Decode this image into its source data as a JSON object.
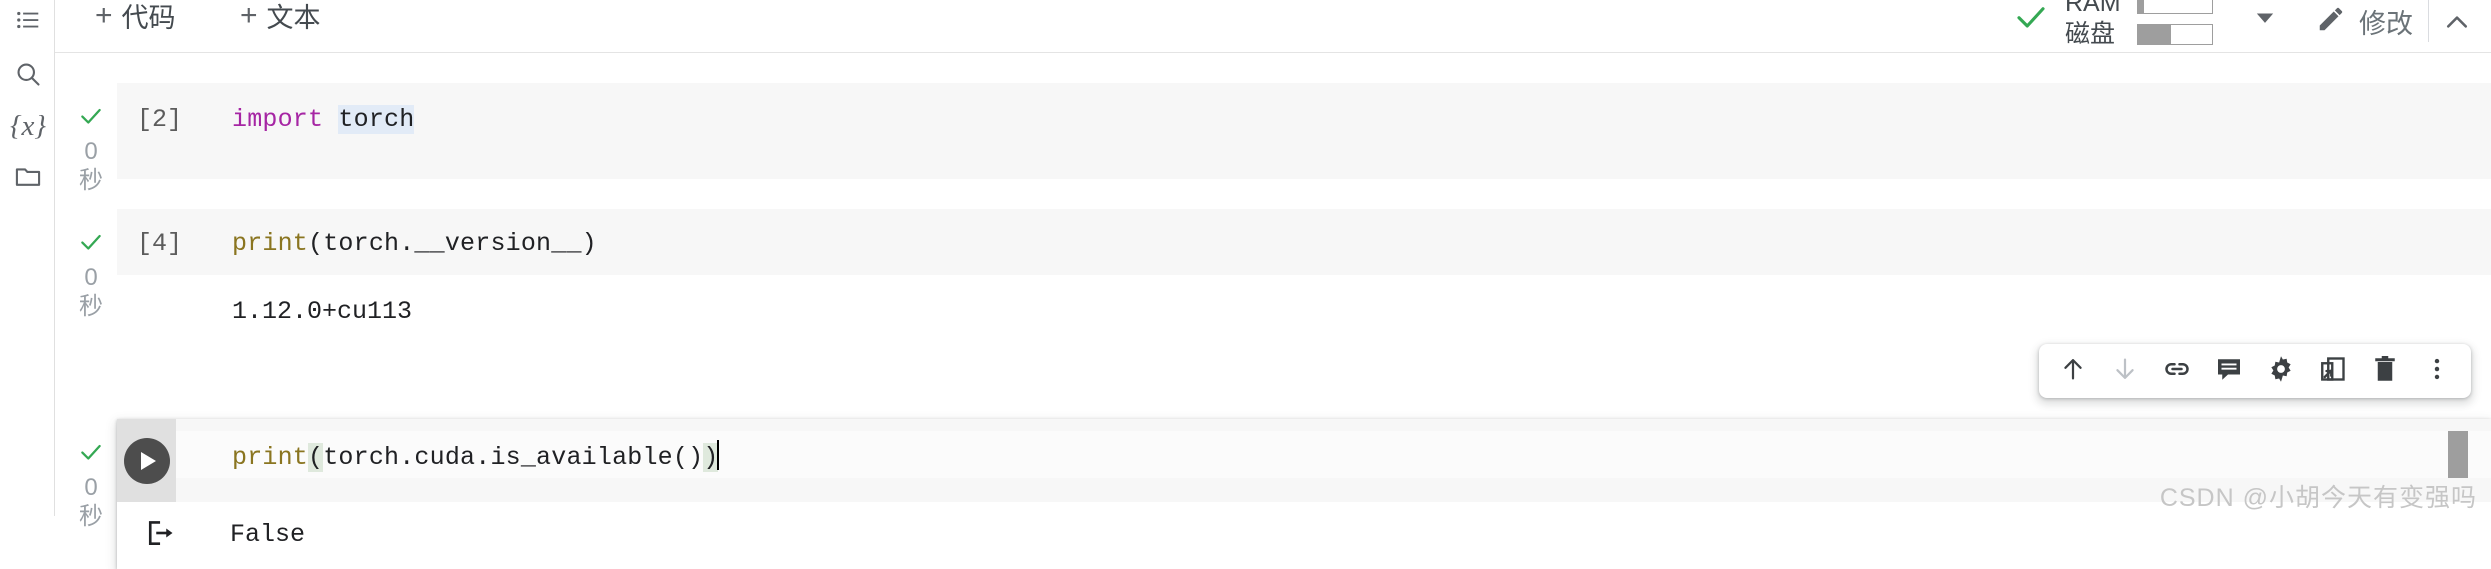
{
  "left_rail": {
    "items": [
      {
        "name": "table-of-contents",
        "icon": "list-icon"
      },
      {
        "name": "search",
        "icon": "search-icon"
      },
      {
        "name": "variables",
        "icon": "variables-icon",
        "glyph": "{x}"
      },
      {
        "name": "files",
        "icon": "folder-icon"
      }
    ]
  },
  "toolbar": {
    "add_code_label": "代码",
    "add_text_label": "文本",
    "plus_glyph": "+",
    "edit_label": "修改",
    "status": {
      "connected_icon": "check-icon",
      "connected_color": "#34a853",
      "ram_label": "RAM",
      "ram_percent": 8,
      "disk_label": "磁盘",
      "disk_percent": 45
    }
  },
  "cells": [
    {
      "exec_count": "[2]",
      "status_icon": "check-icon",
      "duration_value": "0",
      "duration_unit": "秒",
      "code_tokens": [
        {
          "text": "import",
          "style": "kw"
        },
        {
          "text": " ",
          "style": "plain"
        },
        {
          "text": "torch",
          "style": "hl"
        }
      ],
      "output": null
    },
    {
      "exec_count": "[4]",
      "status_icon": "check-icon",
      "duration_value": "0",
      "duration_unit": "秒",
      "code_tokens": [
        {
          "text": "print",
          "style": "fn"
        },
        {
          "text": "(torch.__version__)",
          "style": "plain"
        }
      ],
      "output": "1.12.0+cu113"
    },
    {
      "exec_count": "",
      "status_icon": "check-icon",
      "duration_value": "0",
      "duration_unit": "秒",
      "active": true,
      "run_button_icon": "play-icon",
      "code_parts": {
        "fn": "print",
        "open_paren": "(",
        "body": "torch.cuda.is_available()",
        "close_paren": ")"
      },
      "output": "False",
      "output_icon": "output-arrow-icon"
    }
  ],
  "cell_toolbar": {
    "buttons": [
      {
        "name": "move-cell-up-button",
        "icon": "arrow-up-icon",
        "enabled": true
      },
      {
        "name": "move-cell-down-button",
        "icon": "arrow-down-icon",
        "enabled": false
      },
      {
        "name": "copy-cell-link-button",
        "icon": "link-icon",
        "enabled": true
      },
      {
        "name": "add-comment-button",
        "icon": "comment-icon",
        "enabled": true
      },
      {
        "name": "cell-settings-button",
        "icon": "gear-icon",
        "enabled": true
      },
      {
        "name": "mirror-cell-button",
        "icon": "mirror-icon",
        "enabled": true
      },
      {
        "name": "delete-cell-button",
        "icon": "trash-icon",
        "enabled": true
      },
      {
        "name": "more-options-button",
        "icon": "more-vertical-icon",
        "enabled": true
      }
    ]
  },
  "watermark": {
    "text": "CSDN @小胡今天有变强吗"
  }
}
